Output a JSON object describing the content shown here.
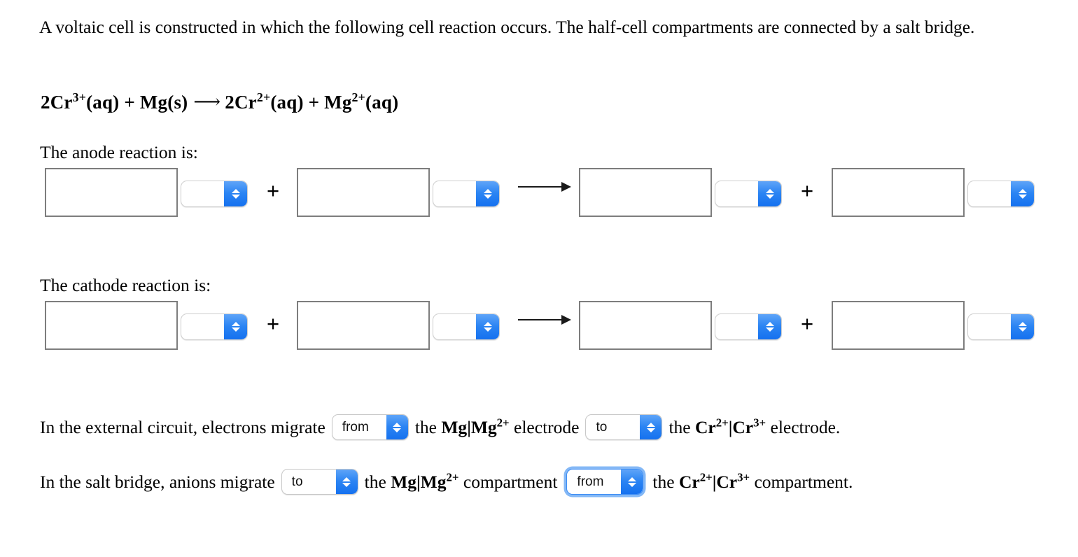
{
  "question": {
    "prompt": "A voltaic cell is constructed in which the following cell reaction occurs. The half-cell compartments are connected by a salt bridge.",
    "equation": {
      "left_coefficient_1": "2Cr",
      "left_charge_1": "3+",
      "left_state_1": "(aq)",
      "plus": "+",
      "left_species_2": "Mg(s)",
      "arrow": "⟶",
      "right_coefficient_1": "2Cr",
      "right_charge_1": "2+",
      "right_state_1": "(aq)",
      "right_species_2": "Mg",
      "right_charge_2": "2+",
      "right_state_2": "(aq)"
    }
  },
  "anode": {
    "label": "The anode reaction is:",
    "inputs": [
      "",
      "",
      "",
      ""
    ],
    "selects": [
      "",
      "",
      "",
      ""
    ],
    "plus_1": "+",
    "plus_2": "+",
    "arrow": "⟶"
  },
  "cathode": {
    "label": "The cathode reaction is:",
    "inputs": [
      "",
      "",
      "",
      ""
    ],
    "selects": [
      "",
      "",
      "",
      ""
    ],
    "plus_1": "+",
    "plus_2": "+",
    "arrow": "⟶"
  },
  "external_circuit": {
    "text_1": "In the external circuit, electrons migrate",
    "select_1": {
      "value": "from",
      "options": [
        "from",
        "to"
      ]
    },
    "text_2": "the",
    "electrode_1": {
      "base_1": "Mg",
      "bar": "|",
      "base_2": "Mg",
      "charge_2": "2+"
    },
    "text_3": "electrode",
    "select_2": {
      "value": "to",
      "options": [
        "from",
        "to"
      ]
    },
    "text_4": "the",
    "electrode_2": {
      "base_1": "Cr",
      "charge_1": "2+",
      "bar": "|",
      "base_2": "Cr",
      "charge_2": "3+"
    },
    "text_5": "electrode."
  },
  "salt_bridge": {
    "text_1": "In the salt bridge, anions migrate",
    "select_1": {
      "value": "to",
      "options": [
        "from",
        "to"
      ]
    },
    "text_2": "the",
    "compartment_1": {
      "base_1": "Mg",
      "bar": "|",
      "base_2": "Mg",
      "charge_2": "2+"
    },
    "text_3": "compartment",
    "select_2": {
      "value": "from",
      "options": [
        "from",
        "to"
      ],
      "focused": true
    },
    "text_4": "the",
    "compartment_2": {
      "base_1": "Cr",
      "charge_1": "2+",
      "bar": "|",
      "base_2": "Cr",
      "charge_2": "3+"
    },
    "text_5": "compartment."
  },
  "colors": {
    "accent_blue": "#2b84f3",
    "focus_ring": "#6eacf5",
    "box_border": "#7d7d7d",
    "text": "#000000",
    "background": "#ffffff"
  }
}
